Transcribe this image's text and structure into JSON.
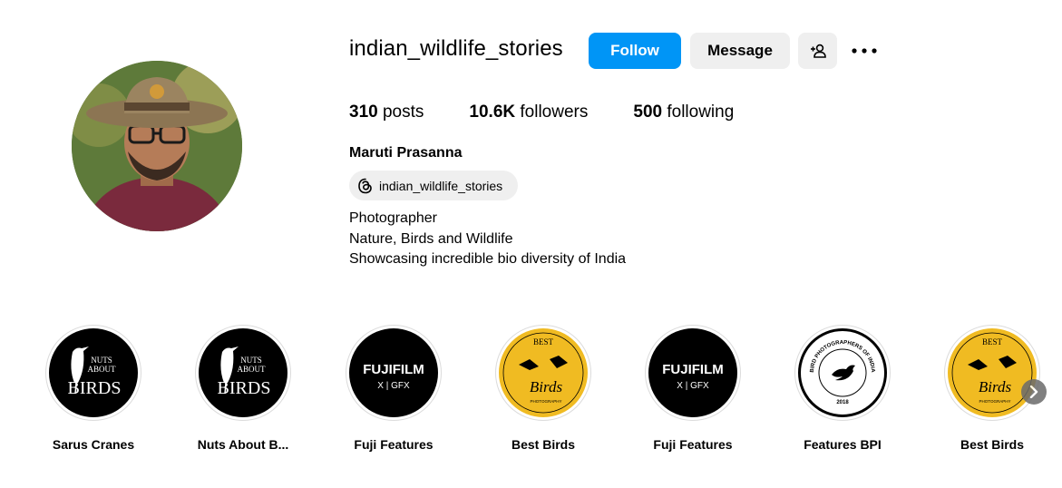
{
  "profile": {
    "username": "indian_wildlife_stories",
    "full_name": "Maruti Prasanna",
    "threads_handle": "indian_wildlife_stories",
    "bio_lines": [
      "Photographer",
      "Nature, Birds and Wildlife",
      "Showcasing incredible bio diversity of India"
    ]
  },
  "actions": {
    "follow_label": "Follow",
    "message_label": "Message",
    "add_user_icon": "person-add-icon",
    "more_icon": "more-options-icon"
  },
  "stats": {
    "posts_count": "310",
    "posts_label": "posts",
    "followers_count": "10.6K",
    "followers_label": "followers",
    "following_count": "500",
    "following_label": "following"
  },
  "highlights": [
    {
      "label": "Sarus Cranes",
      "logo_lines": [
        "NUTS",
        "ABOUT",
        "BIRDS"
      ]
    },
    {
      "label": "Nuts About B...",
      "logo_lines": [
        "NUTS",
        "ABOUT",
        "BIRDS"
      ]
    },
    {
      "label": "Fuji Features",
      "logo_lines": [
        "FUJIFILM",
        "X | GFX"
      ]
    },
    {
      "label": "Best Birds",
      "logo_lines": [
        "BEST",
        "Birds",
        "PHOTOGRAPHY"
      ]
    },
    {
      "label": "Fuji Features",
      "logo_lines": [
        "FUJIFILM",
        "X | GFX"
      ]
    },
    {
      "label": "Features BPI",
      "logo_lines": [
        "BIRD PHOTOGRAPHERS OF INDIA",
        "2018"
      ]
    },
    {
      "label": "Best Birds",
      "logo_lines": [
        "BEST",
        "Birds",
        "PHOTOGRAPHY"
      ]
    }
  ],
  "colors": {
    "follow_button": "#0095f6",
    "secondary_button": "#efefef",
    "best_birds_yellow": "#f0bb22"
  }
}
